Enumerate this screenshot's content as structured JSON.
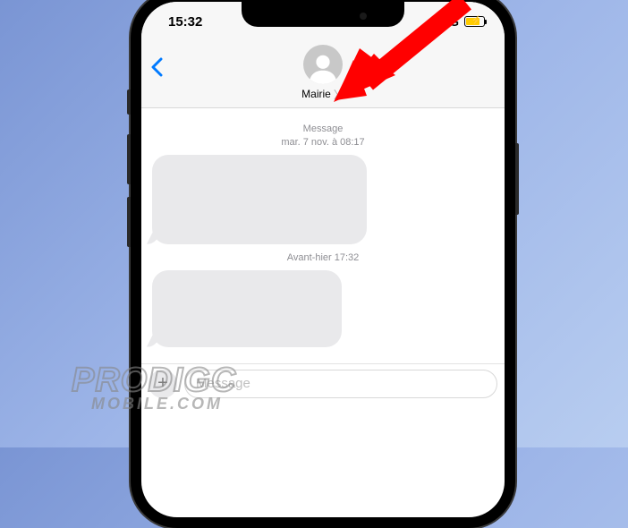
{
  "status": {
    "time": "15:32",
    "network": "4G"
  },
  "header": {
    "contact_name": "Mairie"
  },
  "messages": {
    "ts1_label": "Message",
    "ts1_date": "mar. 7 nov. à 08:17",
    "ts2": "Avant-hier 17:32"
  },
  "composer": {
    "placeholder": "Message"
  },
  "watermark": {
    "line1": "PRODIGC",
    "line2": "MOBILE.COM"
  }
}
